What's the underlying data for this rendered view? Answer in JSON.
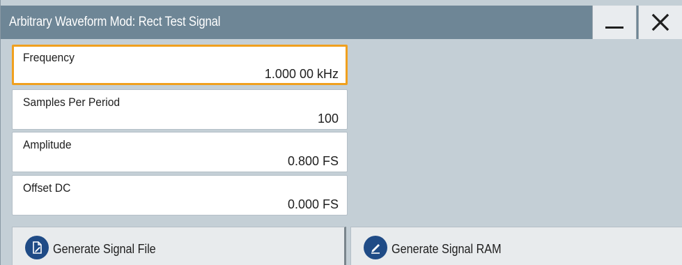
{
  "window": {
    "title": "Arbitrary Waveform Mod: Rect Test Signal",
    "minimize_icon": "minimize-icon",
    "close_icon": "close-icon"
  },
  "fields": [
    {
      "label": "Frequency",
      "value": "1.000 00 kHz",
      "focused": true
    },
    {
      "label": "Samples Per Period",
      "value": "100",
      "focused": false
    },
    {
      "label": "Amplitude",
      "value": "0.800 FS",
      "focused": false
    },
    {
      "label": "Offset DC",
      "value": "0.000 FS",
      "focused": false
    }
  ],
  "buttons": {
    "generate_file": {
      "label": "Generate Signal File",
      "icon": "file-edit-icon"
    },
    "generate_ram": {
      "label": "Generate Signal RAM",
      "icon": "pencil-icon"
    }
  },
  "colors": {
    "titlebar": "#6e8696",
    "panel_background": "#c4cfd6",
    "focus_border": "#f0a01e",
    "icon_badge": "#1f4b86"
  }
}
